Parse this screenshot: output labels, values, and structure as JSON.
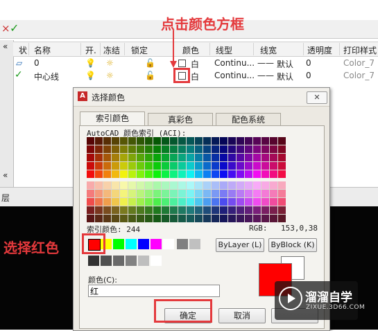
{
  "annotations": {
    "click_color_box": "点击颜色方框",
    "select_red": "选择红色"
  },
  "layer_manager": {
    "toolbar": {
      "icon_x": "×",
      "icon_check": "✓"
    },
    "columns": [
      "状",
      "名称",
      "开.",
      "冻结",
      "锁定",
      "颜色",
      "线型",
      "线宽",
      "透明度",
      "打印样式"
    ],
    "rows": [
      {
        "name": "0",
        "color": "白",
        "linetype": "Continu...",
        "lineweight": "默认",
        "transparency": "0",
        "plotstyle": "Color_7"
      },
      {
        "name": "中心线",
        "color": "白",
        "linetype": "Continu...",
        "lineweight": "默认",
        "transparency": "0",
        "plotstyle": "Color_7"
      }
    ],
    "bottom_label": "层"
  },
  "dialog": {
    "title": "选择颜色",
    "close_label": "✕",
    "tabs": [
      "索引颜色",
      "真彩色",
      "配色系统"
    ],
    "active_tab": 0,
    "aci_caption": "AutoCAD 颜色索引 (ACI):",
    "index_color_label": "索引颜色: 244",
    "rgb_label": "RGB:",
    "rgb_value": "153,0,38",
    "bylayer_label": "ByLayer (L)",
    "byblock_label": "ByBlock (K)",
    "color_field_label": "颜色(C):",
    "color_field_value": "红",
    "ok_label": "确定",
    "cancel_label": "取消",
    "selected_color": "#ff0000",
    "previous_color": "#ffffff"
  },
  "watermark": {
    "brand": "溜溜自学",
    "url": "ZIXUE.3D66.COM"
  }
}
